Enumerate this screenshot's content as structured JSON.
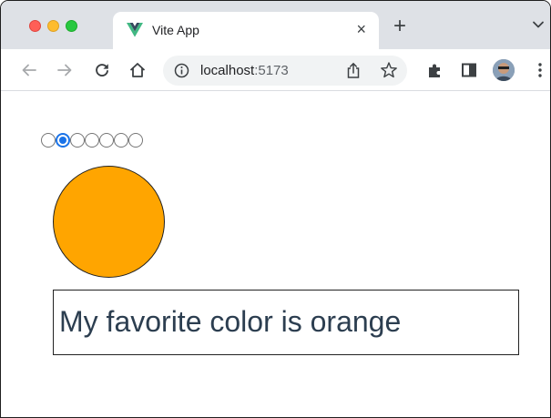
{
  "browser": {
    "tab": {
      "title": "Vite App",
      "close_glyph": "×",
      "favicon": "vue-logo-icon"
    },
    "new_tab_glyph": "+",
    "address_bar": {
      "host": "localhost",
      "port": ":5173"
    }
  },
  "app": {
    "radio_group": {
      "count": 7,
      "selected_index": 1
    },
    "circle_color": "#ffa500",
    "caption": "My favorite color is orange"
  },
  "colors": {
    "tabstrip": "#dee1e6",
    "accent": "#1a73e8",
    "caption_text": "#2c3e50"
  }
}
